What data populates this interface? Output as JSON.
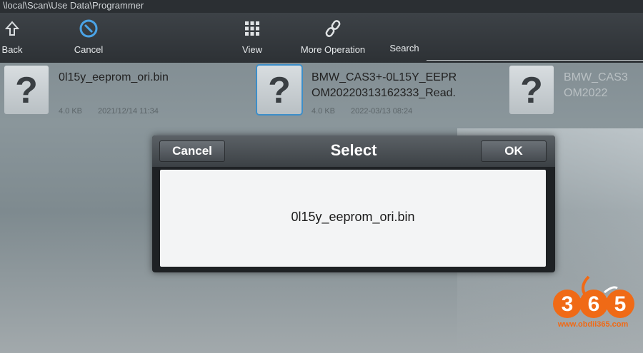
{
  "path_bar": {
    "text": "\\local\\Scan\\Use Data\\Programmer"
  },
  "toolbar": {
    "back_label": "Back",
    "cancel_label": "Cancel",
    "view_label": "View",
    "more_label": "More Operation",
    "search_label": "Search",
    "search_value": ""
  },
  "files": [
    {
      "name": "0l15y_eeprom_ori.bin",
      "size": "4.0 KB",
      "date": "2021/12/14 11:34"
    },
    {
      "name": "BMW_CAS3+-0L15Y_EEPR\nOM20220313162333_Read.",
      "size": "4.0 KB",
      "date": "2022-03/13 08:24"
    },
    {
      "name": "BMW_CAS3\nOM2022",
      "size": "",
      "date": ""
    }
  ],
  "dialog": {
    "title": "Select",
    "cancel_label": "Cancel",
    "ok_label": "OK",
    "message": "0l15y_eeprom_ori.bin"
  },
  "watermark": {
    "logo_text": "365",
    "url": "www.obdii365.com",
    "color": "#f06a16"
  },
  "colors": {
    "toolbar": "#33383c",
    "dialog_header": "#4a4f54",
    "dialog_body": "#f3f4f5",
    "selection": "#3d8ec9"
  }
}
